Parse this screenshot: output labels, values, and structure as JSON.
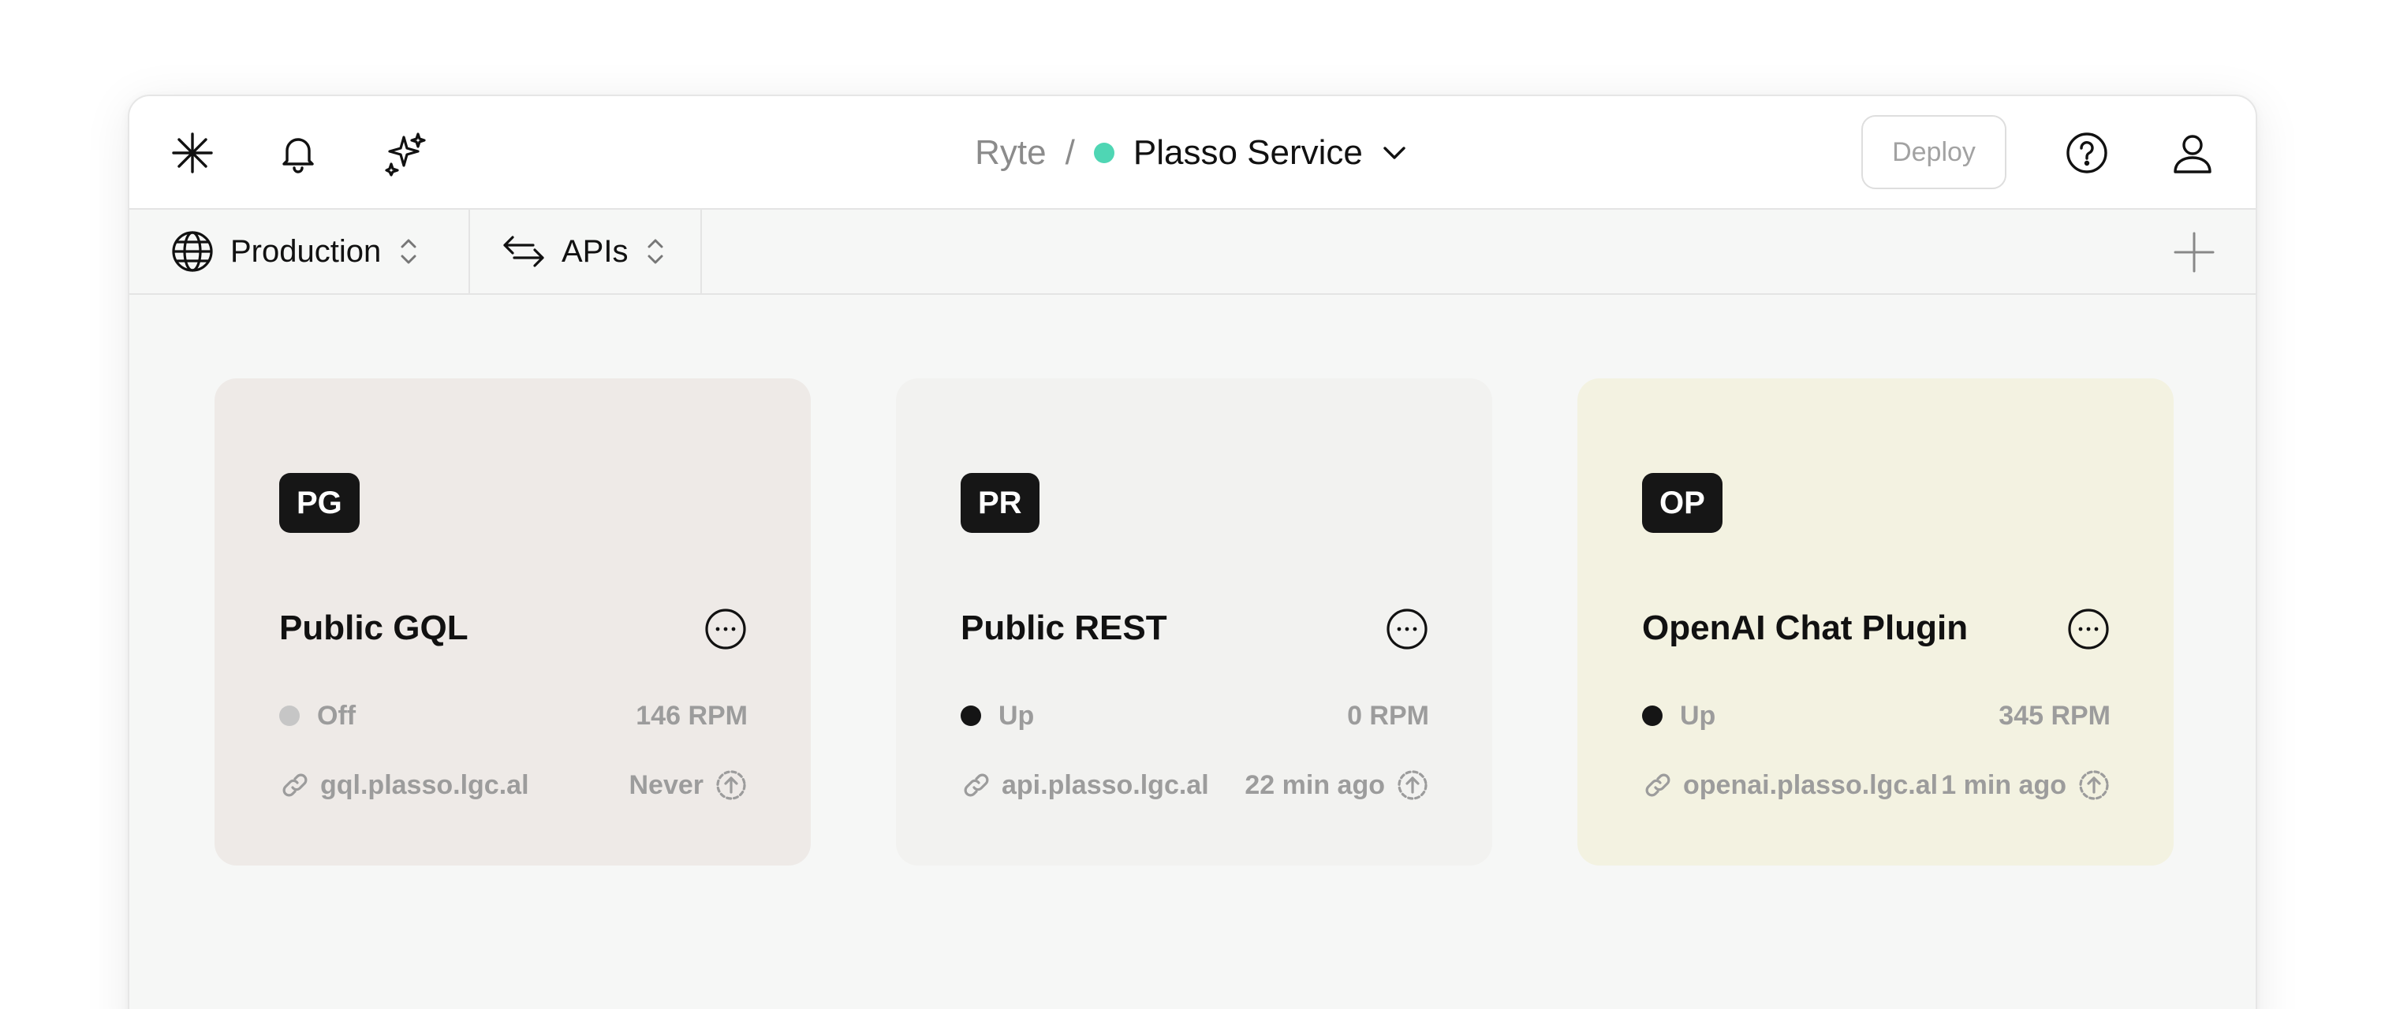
{
  "header": {
    "breadcrumb_root": "Ryte",
    "breadcrumb_separator": "/",
    "service_name": "Plasso Service",
    "service_status_color": "#4fd6b4",
    "deploy_label": "Deploy",
    "left_icons": [
      "sparkle-icon",
      "bell-icon",
      "magic-stars-icon"
    ],
    "right_icons": [
      "help-icon",
      "user-icon"
    ]
  },
  "subbar": {
    "environment": "Production",
    "category": "APIs"
  },
  "cards": [
    {
      "badge": "PG",
      "title": "Public GQL",
      "status": "Off",
      "rpm": "146 RPM",
      "url": "gql.plasso.lgc.al",
      "last_deploy": "Never",
      "background": "#eeeae7"
    },
    {
      "badge": "PR",
      "title": "Public REST",
      "status": "Up",
      "rpm": "0 RPM",
      "url": "api.plasso.lgc.al",
      "last_deploy": "22 min ago",
      "background": "#f2f2f0"
    },
    {
      "badge": "OP",
      "title": "OpenAI Chat Plugin",
      "status": "Up",
      "rpm": "345 RPM",
      "url": "openai.plasso.lgc.al",
      "last_deploy": "1 min ago",
      "background": "#f3f2e1"
    }
  ]
}
